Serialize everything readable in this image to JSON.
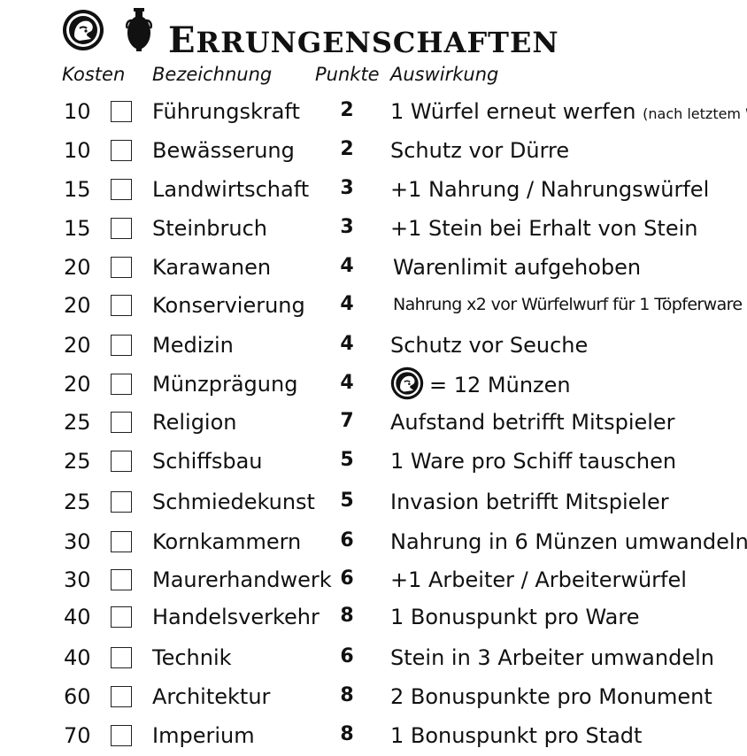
{
  "header": {
    "title_initial": "E",
    "title_rest": "RRUNGENSCHAFTEN",
    "icons": [
      "coin-icon",
      "vase-icon"
    ]
  },
  "columns": {
    "cost": "Kosten",
    "name": "Bezeichnung",
    "points": "Punkte",
    "effect": "Auswirkung"
  },
  "rows": [
    {
      "cost": "10",
      "name": "Führungskraft",
      "points": "2",
      "effect": "1 Würfel erneut werfen",
      "note": "(nach letztem Wurf)"
    },
    {
      "cost": "10",
      "name": "Bewässerung",
      "points": "2",
      "effect": "Schutz vor Dürre"
    },
    {
      "cost": "15",
      "name": "Landwirtschaft",
      "points": "3",
      "effect": "+1 Nahrung / Nahrungswürfel"
    },
    {
      "cost": "15",
      "name": "Steinbruch",
      "points": "3",
      "effect": "+1 Stein bei Erhalt von Stein"
    },
    {
      "cost": "20",
      "name": "Karawanen",
      "points": "4",
      "effect": "Warenlimit aufgehoben"
    },
    {
      "cost": "20",
      "name": "Konservierung",
      "points": "4",
      "effect": "Nahrung x2 vor Würfelwurf für 1 Töpferware"
    },
    {
      "cost": "20",
      "name": "Medizin",
      "points": "4",
      "effect": "Schutz vor Seuche"
    },
    {
      "cost": "20",
      "name": "Münzprägung",
      "points": "4",
      "effect": "= 12 Münzen",
      "effect_icon": "coin-icon"
    },
    {
      "cost": "25",
      "name": "Religion",
      "points": "7",
      "effect": "Aufstand betrifft Mitspieler"
    },
    {
      "cost": "25",
      "name": "Schiffsbau",
      "points": "5",
      "effect": "1 Ware pro Schiff tauschen"
    },
    {
      "cost": "25",
      "name": "Schmiedekunst",
      "points": "5",
      "effect": "Invasion betrifft Mitspieler"
    },
    {
      "cost": "30",
      "name": "Kornkammern",
      "points": "6",
      "effect": "Nahrung in 6 Münzen umwandeln"
    },
    {
      "cost": "30",
      "name": "Maurerhandwerk",
      "points": "6",
      "effect": "+1 Arbeiter / Arbeiterwürfel"
    },
    {
      "cost": "40",
      "name": "Handelsverkehr",
      "points": "8",
      "effect": "1 Bonuspunkt pro Ware"
    },
    {
      "cost": "40",
      "name": "Technik",
      "points": "6",
      "effect": "Stein in 3 Arbeiter umwandeln"
    },
    {
      "cost": "60",
      "name": "Architektur",
      "points": "8",
      "effect": "2 Bonuspunkte pro Monument"
    },
    {
      "cost": "70",
      "name": "Imperium",
      "points": "8",
      "effect": "1 Bonuspunkt pro Stadt"
    }
  ]
}
